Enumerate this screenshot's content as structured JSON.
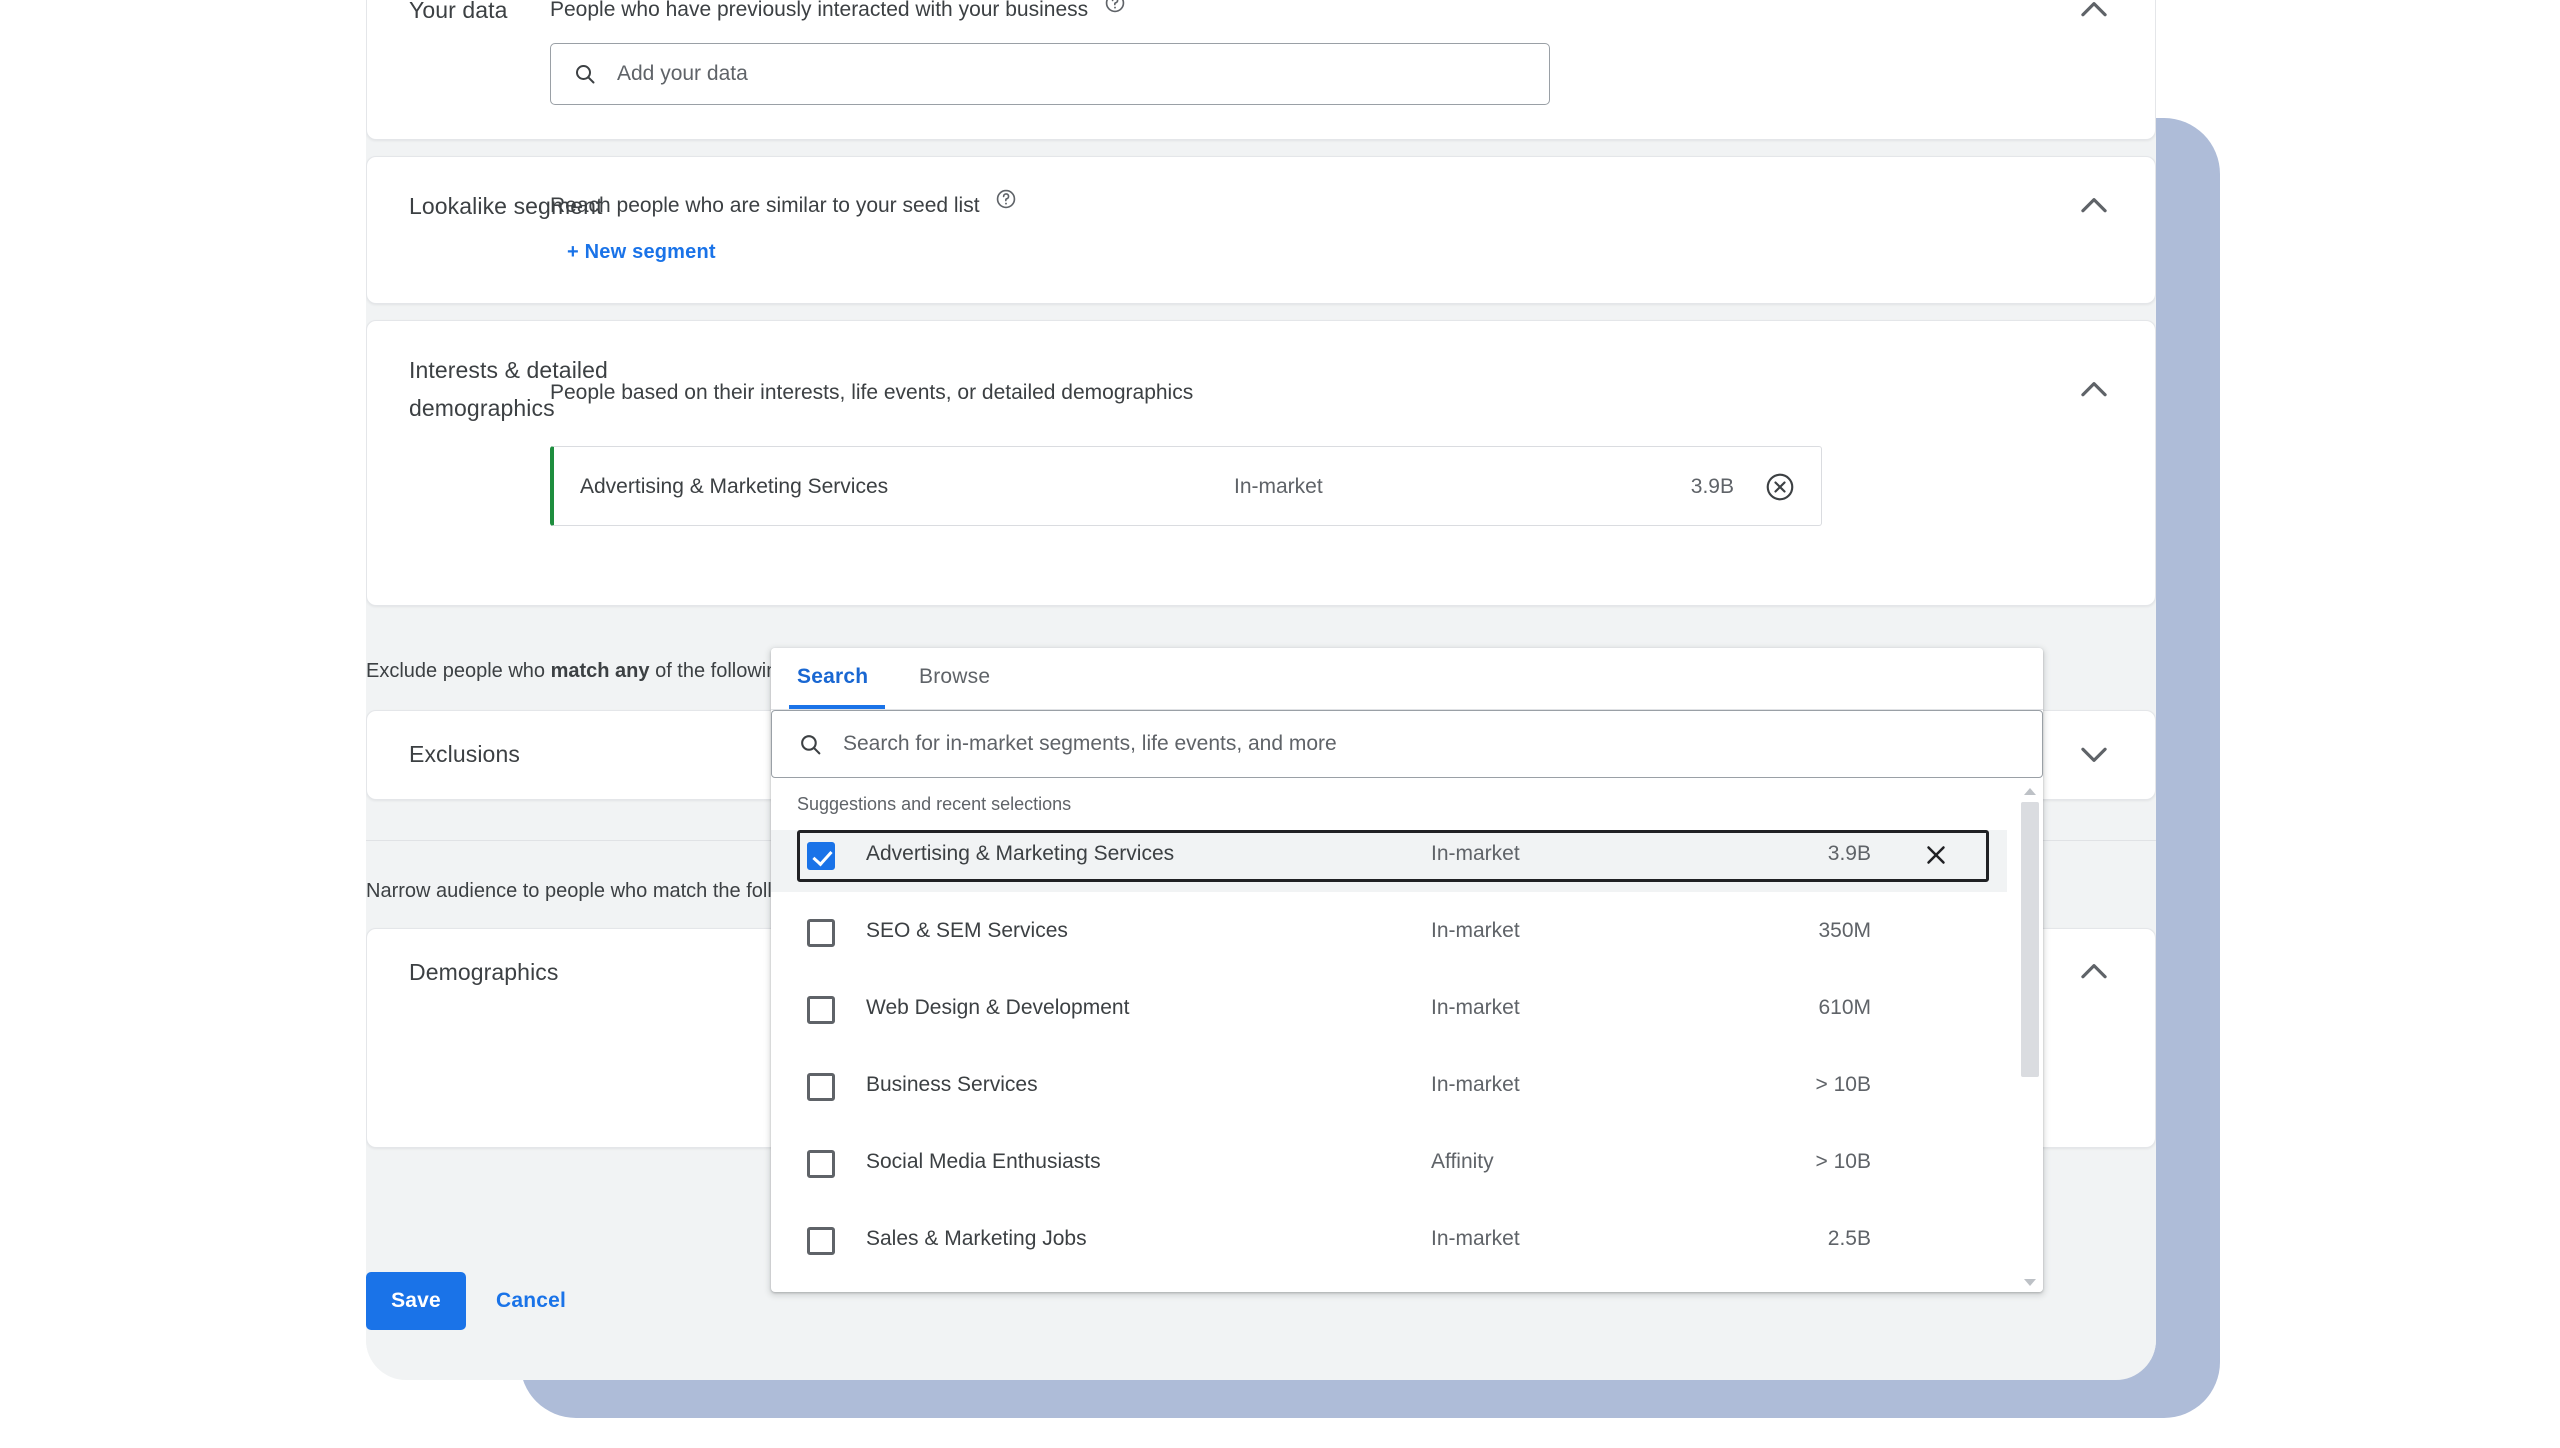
{
  "sections": [
    {
      "label": "Your data",
      "description": "People who have previously interacted with your business",
      "has_help_icon": true,
      "chevron": "chevron-up",
      "input_placeholder": "Add your data"
    },
    {
      "label": "Lookalike segment",
      "description": "Reach people who are similar to your seed list",
      "has_help_icon": true,
      "chevron": "chevron-up",
      "link_label": "+ New segment"
    },
    {
      "label_line1": "Interests & detailed",
      "label_line2": "demographics",
      "description": "People based on their interests, life events, or detailed demographics",
      "has_help_icon": false,
      "chevron": "chevron-up",
      "selected_chip": {
        "name": "Advertising & Marketing Services",
        "type": "In-market",
        "size": "3.9B",
        "remove_icon": "remove-circle-icon"
      }
    },
    {
      "label": "Exclusions",
      "chevron": "chevron-down"
    },
    {
      "label": "Demographics",
      "chevron": "chevron-up"
    }
  ],
  "notes": {
    "exclude_prefix": "Exclude people who ",
    "exclude_bold": "match any",
    "exclude_suffix": " of the following",
    "narrow_text": "Narrow audience to people who match the following"
  },
  "dropdown": {
    "tabs": [
      {
        "label": "Search",
        "active": true
      },
      {
        "label": "Browse",
        "active": false
      }
    ],
    "search_placeholder": "Search for in-market segments, life events, and more",
    "search_value": "",
    "list_header": "Suggestions and recent selections",
    "options": [
      {
        "name": "Advertising & Marketing Services",
        "type": "In-market",
        "size": "3.9B",
        "checked": true,
        "highlighted": true,
        "has_clear": true
      },
      {
        "name": "SEO & SEM Services",
        "type": "In-market",
        "size": "350M",
        "checked": false,
        "highlighted": false,
        "has_clear": false
      },
      {
        "name": "Web Design & Development",
        "type": "In-market",
        "size": "610M",
        "checked": false,
        "highlighted": false,
        "has_clear": false
      },
      {
        "name": "Business Services",
        "type": "In-market",
        "size": "> 10B",
        "checked": false,
        "highlighted": false,
        "has_clear": false
      },
      {
        "name": "Social Media Enthusiasts",
        "type": "Affinity",
        "size": "> 10B",
        "checked": false,
        "highlighted": false,
        "has_clear": false
      },
      {
        "name": "Sales & Marketing Jobs",
        "type": "In-market",
        "size": "2.5B",
        "checked": false,
        "highlighted": false,
        "has_clear": false
      }
    ]
  },
  "actions": {
    "save_label": "Save",
    "cancel_label": "Cancel"
  },
  "colors": {
    "accent_blue": "#1a73e8",
    "selected_green": "#1e8e3e",
    "backing_panel": "#aebcd8",
    "surface_grey": "#f1f3f4"
  }
}
